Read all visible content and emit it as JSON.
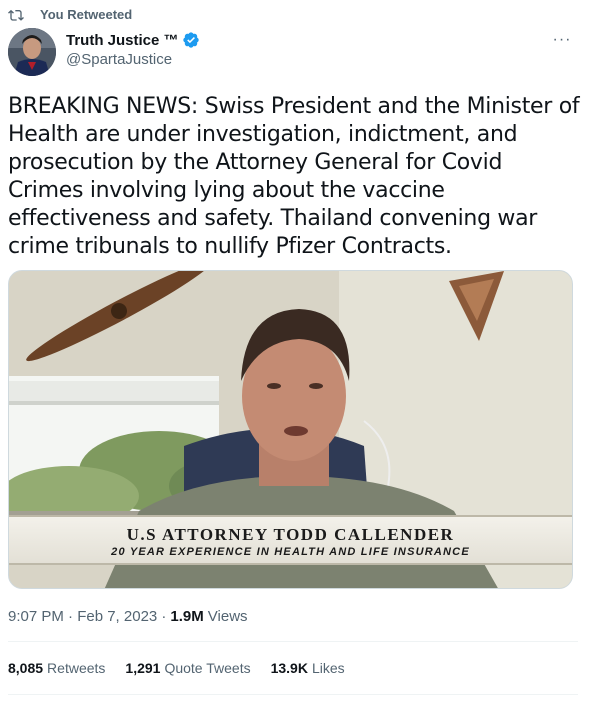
{
  "retweet_header": {
    "label": "You Retweeted",
    "icon": "retweet-icon"
  },
  "author": {
    "name": "Truth Justice ™",
    "handle": "@SpartaJustice",
    "verified_icon": "verified-badge-icon",
    "verified_color": "#1d9bf0"
  },
  "menu": {
    "icon": "more-options-icon",
    "glyph": "···"
  },
  "tweet": {
    "text": "BREAKING NEWS: Swiss President and the Minister of Health are under investigation, indictment, and prosecution by the Attorney General for Covid Crimes involving lying about the vaccine effectiveness and safety. Thailand convening war crime tribunals to nullify Pfizer Contracts."
  },
  "media": {
    "lower_third_line1": "U.S ATTORNEY TODD CALLENDER",
    "lower_third_line2": "20 YEAR EXPERIENCE IN HEALTH AND LIFE INSURANCE"
  },
  "meta": {
    "timestamp": "9:07 PM · Feb 7, 2023 ·",
    "views_count": "1.9M",
    "views_label": "Views"
  },
  "stats": {
    "retweets_count": "8,085",
    "retweets_label": "Retweets",
    "quotes_count": "1,291",
    "quotes_label": "Quote Tweets",
    "likes_count": "13.9K",
    "likes_label": "Likes"
  },
  "colors": {
    "text_primary": "#0f1419",
    "text_secondary": "#536471",
    "accent": "#1d9bf0",
    "divider": "#eff3f4"
  }
}
